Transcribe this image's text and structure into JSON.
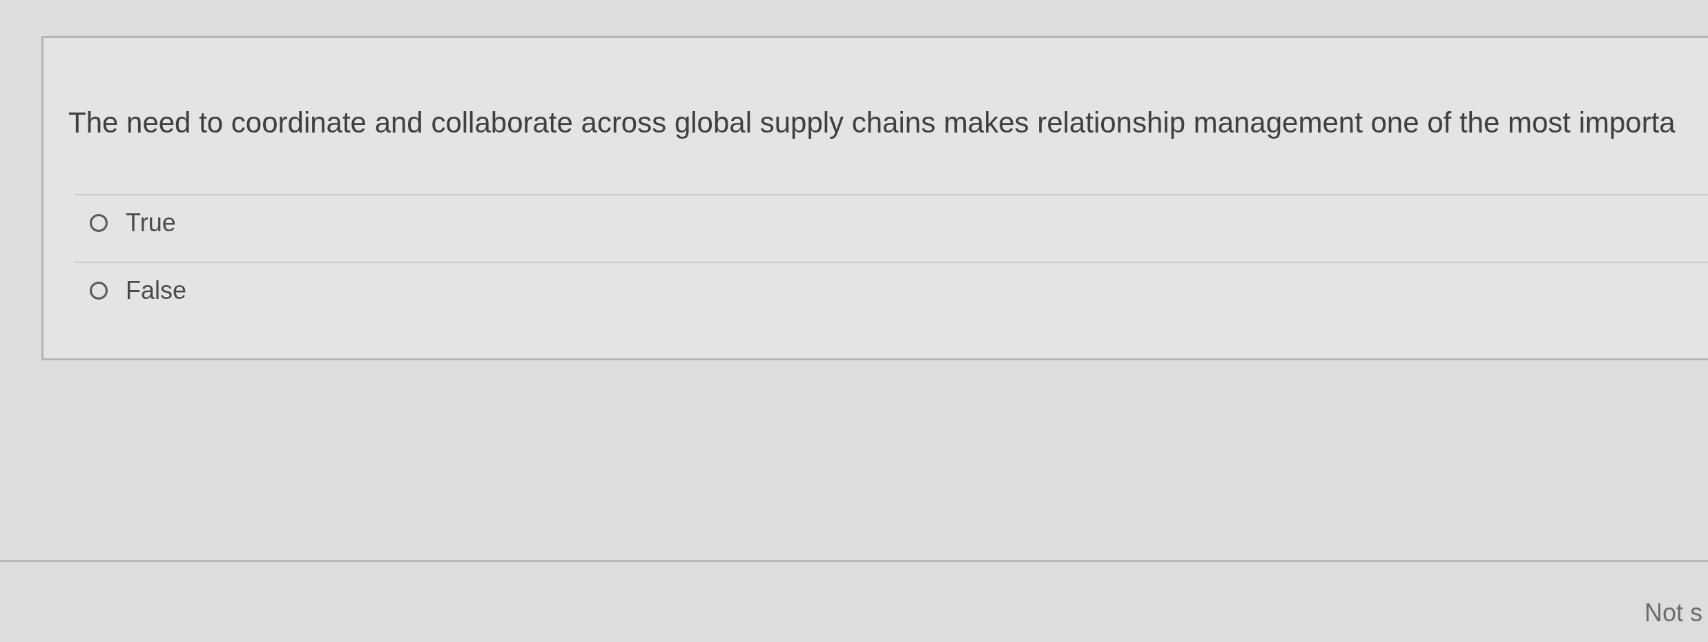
{
  "question": {
    "text": "The need to coordinate and collaborate across global supply chains makes relationship management one of the most importa"
  },
  "options": [
    {
      "label": "True",
      "selected": false
    },
    {
      "label": "False",
      "selected": false
    }
  ],
  "footer": {
    "status": "Not s"
  }
}
